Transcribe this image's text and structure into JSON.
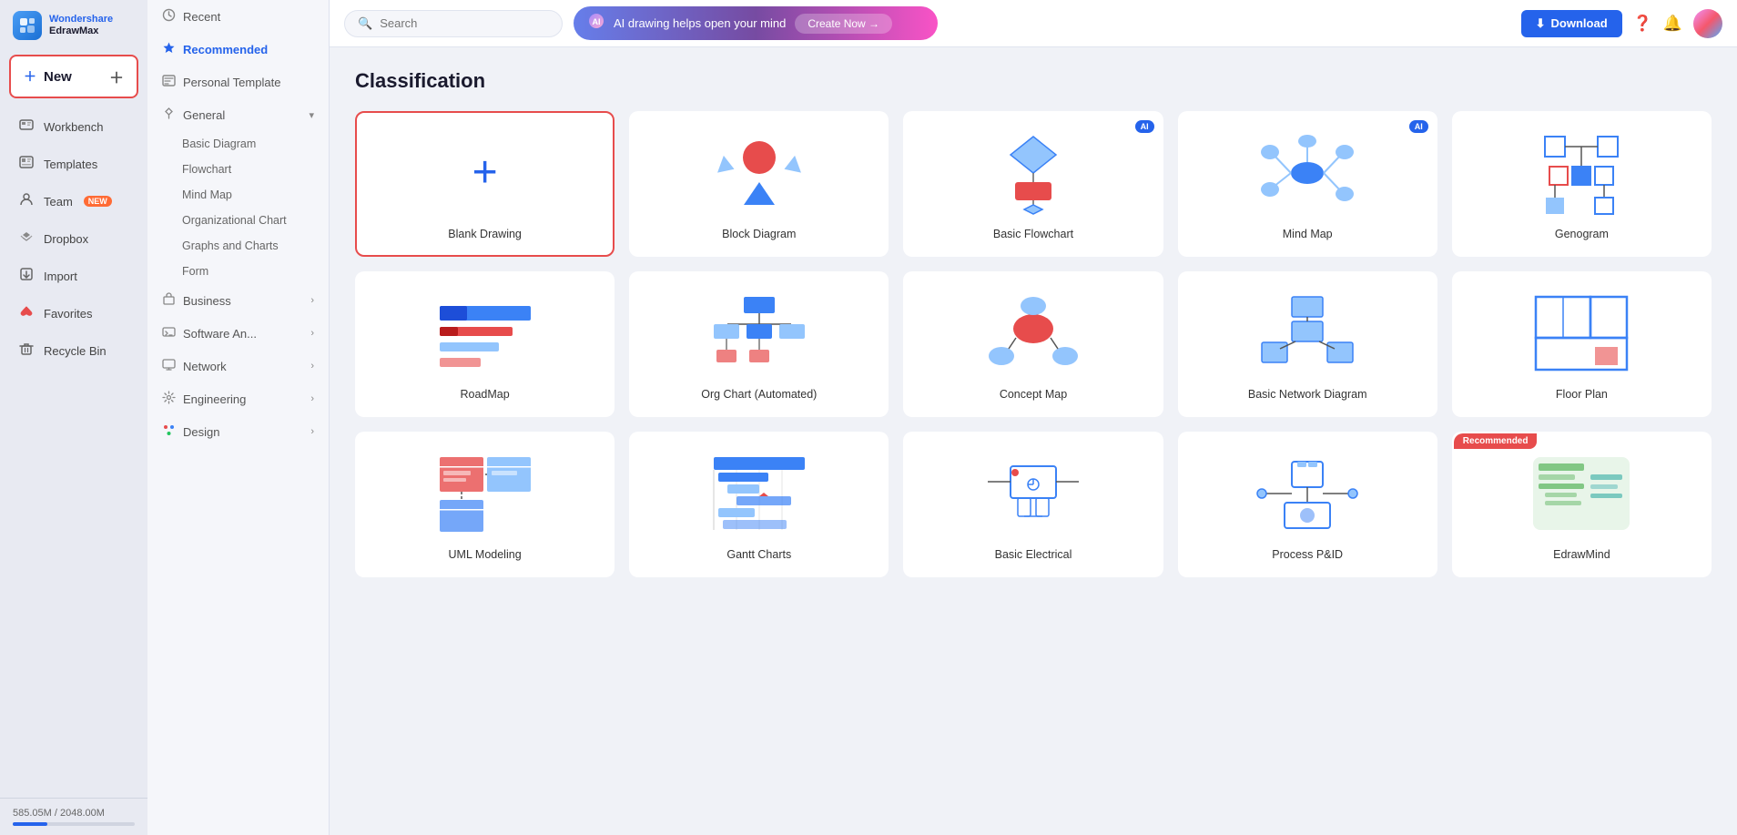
{
  "app": {
    "name": "EdrawMax",
    "logo_initials": "E"
  },
  "sidebar": {
    "new_label": "New",
    "nav_items": [
      {
        "id": "workbench",
        "label": "Workbench",
        "icon": "🖥"
      },
      {
        "id": "templates",
        "label": "Templates",
        "icon": "📋"
      },
      {
        "id": "team",
        "label": "Team",
        "icon": "👤",
        "badge": "NEW"
      },
      {
        "id": "dropbox",
        "label": "Dropbox",
        "icon": "📦"
      },
      {
        "id": "import",
        "label": "Import",
        "icon": "📥"
      },
      {
        "id": "favorites",
        "label": "Favorites",
        "icon": "❤"
      },
      {
        "id": "recycle",
        "label": "Recycle Bin",
        "icon": "🗑"
      }
    ],
    "storage_used": "585.05M",
    "storage_total": "2048.00M",
    "storage_percent": 28.5
  },
  "left_panel": {
    "items": [
      {
        "id": "recent",
        "label": "Recent",
        "icon": "🕐",
        "active": false
      },
      {
        "id": "recommended",
        "label": "Recommended",
        "icon": "★",
        "active": true
      },
      {
        "id": "personal",
        "label": "Personal Template",
        "icon": "☰",
        "active": false
      }
    ],
    "sections": [
      {
        "id": "general",
        "label": "General",
        "icon": "◇",
        "expanded": true,
        "sub_items": [
          "Basic Diagram",
          "Flowchart",
          "Mind Map",
          "Organizational Chart",
          "Graphs and Charts",
          "Form"
        ]
      },
      {
        "id": "business",
        "label": "Business",
        "icon": "💼",
        "expanded": false,
        "sub_items": []
      },
      {
        "id": "software",
        "label": "Software An...",
        "icon": "⚙",
        "expanded": false,
        "sub_items": []
      },
      {
        "id": "network",
        "label": "Network",
        "icon": "🌐",
        "expanded": false,
        "sub_items": []
      },
      {
        "id": "engineering",
        "label": "Engineering",
        "icon": "🔧",
        "expanded": false,
        "sub_items": []
      },
      {
        "id": "design",
        "label": "Design",
        "icon": "🎨",
        "expanded": false,
        "sub_items": []
      }
    ]
  },
  "topbar": {
    "search_placeholder": "Search",
    "ai_banner_text": "AI drawing helps open your mind",
    "ai_banner_btn": "Create Now →",
    "download_btn": "Download"
  },
  "main": {
    "section_title": "Classification",
    "cards": [
      {
        "id": "blank",
        "label": "Blank Drawing",
        "type": "blank",
        "selected": true,
        "ai": false,
        "recommended": false
      },
      {
        "id": "block",
        "label": "Block Diagram",
        "type": "block",
        "selected": false,
        "ai": false,
        "recommended": false
      },
      {
        "id": "flowchart",
        "label": "Basic Flowchart",
        "type": "flowchart",
        "selected": false,
        "ai": true,
        "recommended": false
      },
      {
        "id": "mindmap",
        "label": "Mind Map",
        "type": "mindmap",
        "selected": false,
        "ai": true,
        "recommended": false
      },
      {
        "id": "genogram",
        "label": "Genogram",
        "type": "genogram",
        "selected": false,
        "ai": false,
        "recommended": false
      },
      {
        "id": "roadmap",
        "label": "RoadMap",
        "type": "roadmap",
        "selected": false,
        "ai": false,
        "recommended": false
      },
      {
        "id": "orgchart",
        "label": "Org Chart (Automated)",
        "type": "orgchart",
        "selected": false,
        "ai": false,
        "recommended": false
      },
      {
        "id": "concept",
        "label": "Concept Map",
        "type": "concept",
        "selected": false,
        "ai": false,
        "recommended": false
      },
      {
        "id": "network",
        "label": "Basic Network Diagram",
        "type": "network",
        "selected": false,
        "ai": false,
        "recommended": false
      },
      {
        "id": "floorplan",
        "label": "Floor Plan",
        "type": "floorplan",
        "selected": false,
        "ai": false,
        "recommended": false
      },
      {
        "id": "uml",
        "label": "UML Modeling",
        "type": "uml",
        "selected": false,
        "ai": false,
        "recommended": false
      },
      {
        "id": "gantt",
        "label": "Gantt Charts",
        "type": "gantt",
        "selected": false,
        "ai": false,
        "recommended": false
      },
      {
        "id": "electrical",
        "label": "Basic Electrical",
        "type": "electrical",
        "selected": false,
        "ai": false,
        "recommended": false
      },
      {
        "id": "pid",
        "label": "Process P&ID",
        "type": "pid",
        "selected": false,
        "ai": false,
        "recommended": false
      },
      {
        "id": "edrawmind",
        "label": "EdrawMind",
        "type": "edrawmind",
        "selected": false,
        "ai": false,
        "recommended": true
      }
    ]
  }
}
